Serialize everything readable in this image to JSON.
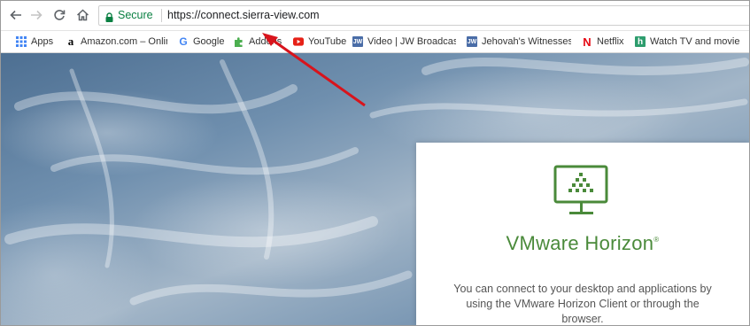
{
  "toolbar": {
    "back_icon": "back-arrow-icon",
    "forward_icon": "forward-arrow-icon",
    "reload_icon": "reload-icon",
    "home_icon": "home-icon",
    "secure_label": "Secure",
    "url": "https://connect.sierra-view.com"
  },
  "bookmarks": [
    {
      "label": "Apps",
      "icon": "apps-grid-icon",
      "color": "#4285f4"
    },
    {
      "label": "Amazon.com – Onlin",
      "icon": "amazon-icon",
      "color": "#000000"
    },
    {
      "label": "Google",
      "icon": "google-icon",
      "color": "#4285f4"
    },
    {
      "label": "Addons",
      "icon": "puzzle-icon",
      "color": "#4caf50"
    },
    {
      "label": "YouTube",
      "icon": "youtube-icon",
      "color": "#e62117"
    },
    {
      "label": "Video | JW Broadcast",
      "icon": "jw-icon",
      "color": "#4a6da7"
    },
    {
      "label": "Jehovah's Witnesses-",
      "icon": "jw-icon",
      "color": "#4a6da7"
    },
    {
      "label": "Netflix",
      "icon": "netflix-icon",
      "color": "#e50914"
    },
    {
      "label": "Watch TV and movie",
      "icon": "h-icon",
      "color": "#2e9d6e"
    }
  ],
  "panel": {
    "brand": "VMware Horizon",
    "brand_mark": "®",
    "description": "You can connect to your desktop and applications by using the VMware Horizon Client or through the browser."
  },
  "colors": {
    "brand_green": "#4a8a3a",
    "secure_green": "#0b8043",
    "annotation_arrow": "#d8141c"
  }
}
